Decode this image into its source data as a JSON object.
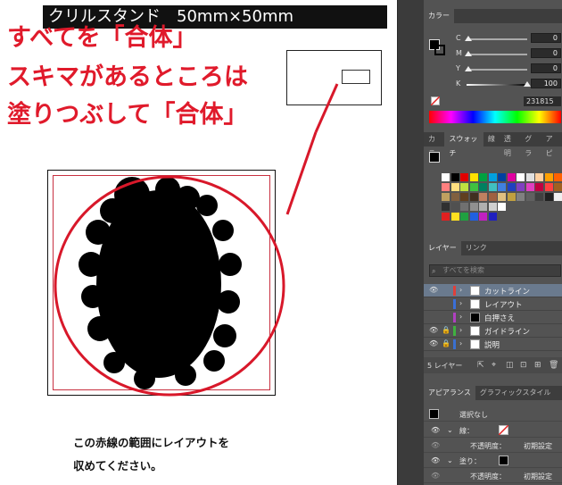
{
  "document": {
    "title": "クリルスタンド　50mm×50mm"
  },
  "annotation": {
    "line1": "すべてを「合体」",
    "line2": "スキマがあるところは",
    "line3": "塗りつぶして「合体」"
  },
  "artboard": {
    "caption_line1": "この赤線の範囲にレイアウトを",
    "caption_line2": "収めてください。"
  },
  "colors": {
    "annotation_red": "#e01a2b",
    "panel_bg": "#535353",
    "selected_layer": "#6a7a8e"
  },
  "color_panel": {
    "tab": "カラー",
    "sliders": [
      {
        "label": "C",
        "value": "0"
      },
      {
        "label": "M",
        "value": "0"
      },
      {
        "label": "Y",
        "value": "0"
      },
      {
        "label": "K",
        "value": "100"
      }
    ],
    "hex": "231815"
  },
  "swatch_panel": {
    "tabs": [
      "カラ",
      "スウォッチ",
      "線",
      "透明",
      "グラ",
      "アピ"
    ],
    "active_tab": "スウォッチ"
  },
  "layers_panel": {
    "tabs": [
      "レイヤー",
      "リンク"
    ],
    "search_placeholder": "すべてを検索",
    "layers": [
      {
        "name": "カットライン",
        "color": "#e0403a",
        "visible": true,
        "locked": false,
        "selected": true
      },
      {
        "name": "レイアウト",
        "color": "#3a6fd8",
        "visible": false,
        "locked": false,
        "selected": false
      },
      {
        "name": "白押さえ",
        "color": "#b040c0",
        "visible": false,
        "locked": false,
        "selected": false
      },
      {
        "name": "ガイドライン",
        "color": "#40b040",
        "visible": true,
        "locked": true,
        "selected": false
      },
      {
        "name": "説明",
        "color": "#3a70d0",
        "visible": true,
        "locked": true,
        "selected": false
      }
    ],
    "footer_count": "5 レイヤー"
  },
  "appearance_panel": {
    "tabs": [
      "アピアランス",
      "グラフィックスタイル"
    ],
    "object_label": "選択なし",
    "stroke_label": "線：",
    "fill_label": "塗り：",
    "opacity_label": "不透明度：",
    "opacity_value": "初期設定"
  }
}
